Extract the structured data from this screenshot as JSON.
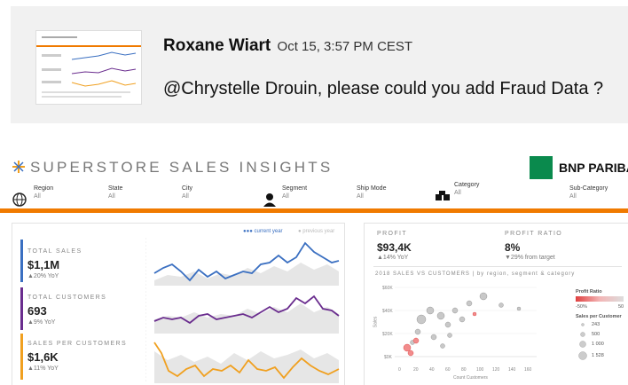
{
  "comment": {
    "author": "Roxane Wiart",
    "time": "Oct 15, 3:57 PM CEST",
    "message": "@Chrystelle Drouin, please could you add Fraud Data ?"
  },
  "dashboard": {
    "title": "SUPERSTORE SALES INSIGHTS",
    "brand": "BNP PARIBAS",
    "filters": [
      {
        "label": "Region",
        "value": "All"
      },
      {
        "label": "State",
        "value": "All"
      },
      {
        "label": "City",
        "value": "All"
      },
      {
        "label": "Segment",
        "value": "All"
      },
      {
        "label": "Ship Mode",
        "value": "All"
      },
      {
        "label": "Category",
        "value": "All"
      },
      {
        "label": "Sub-Category",
        "value": "All"
      }
    ],
    "legend": {
      "current": "●●● current year",
      "previous": "● previous year"
    },
    "kpis": [
      {
        "label": "TOTAL SALES",
        "value": "$1,1M",
        "change": "▲20% YoY",
        "color": "#3a6fc1"
      },
      {
        "label": "TOTAL CUSTOMERS",
        "value": "693",
        "change": "▲9% YoY",
        "color": "#6a2d8e"
      },
      {
        "label": "SALES PER CUSTOMERS",
        "value": "$1,6K",
        "change": "▲11% YoY",
        "color": "#f0a020"
      }
    ],
    "profit": {
      "label": "PROFIT",
      "value": "$93,4K",
      "change": "▲14% YoY"
    },
    "ratio": {
      "label": "PROFIT RATIO",
      "value": "8%",
      "change": "▼29% from target"
    },
    "scatter": {
      "title": "2018 SALES VS CUSTOMERS | by region, segment & category",
      "ylabel": "Sales",
      "xlabel": "Count Customers",
      "yticks": [
        "$60K",
        "$40K",
        "$20K",
        "$0K"
      ],
      "xticks": [
        "0",
        "20",
        "40",
        "60",
        "80",
        "100",
        "120",
        "140",
        "160"
      ],
      "legend_ratio_title": "Profit Ratio",
      "legend_ratio_min": "-50%",
      "legend_ratio_max": "50",
      "legend_size_title": "Sales per Customer",
      "legend_sizes": [
        "243",
        "500",
        "1 000",
        "1 528"
      ]
    },
    "colors": {
      "accent": "#f07a00",
      "sales": "#3a6fc1",
      "customers": "#6a2d8e",
      "spc": "#f0a020"
    }
  }
}
